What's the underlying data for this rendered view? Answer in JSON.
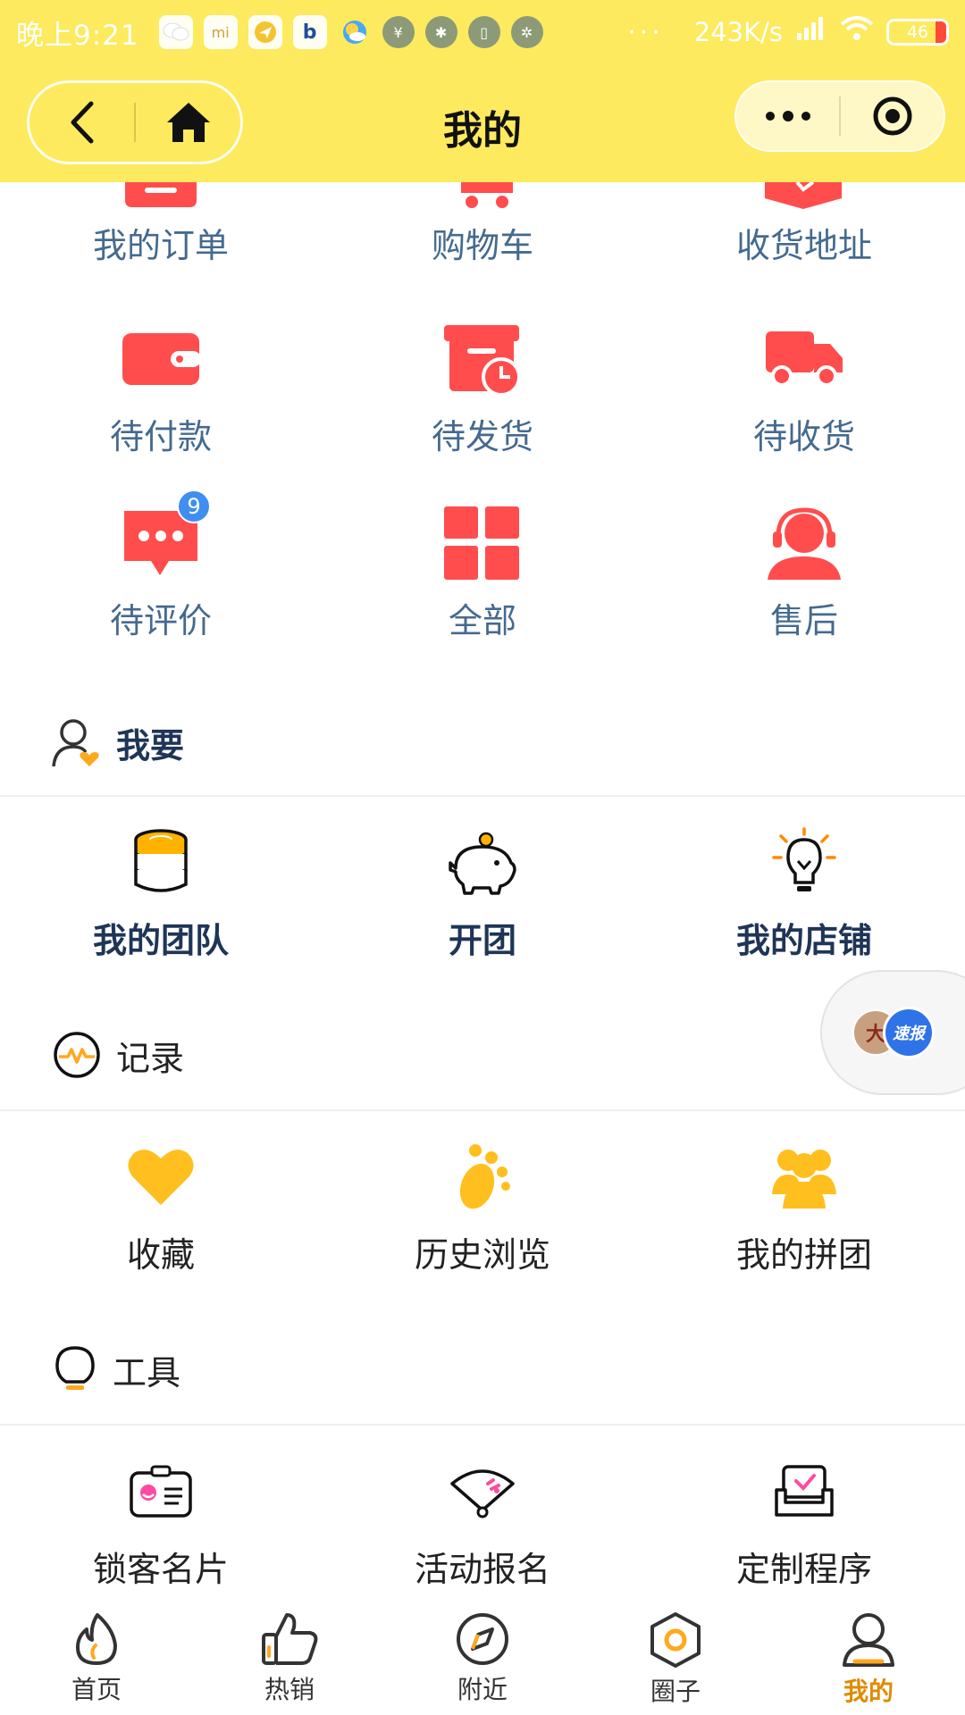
{
  "status_bar": {
    "time": "晚上9:21",
    "speed": "243K/s",
    "battery": "46"
  },
  "nav": {
    "title": "我的"
  },
  "orders": {
    "row1": [
      {
        "label": "我的订单",
        "icon": "order-icon"
      },
      {
        "label": "购物车",
        "icon": "cart-icon"
      },
      {
        "label": "收货地址",
        "icon": "address-icon"
      }
    ],
    "row2": [
      {
        "label": "待付款",
        "icon": "wallet-icon"
      },
      {
        "label": "待发货",
        "icon": "box-clock-icon"
      },
      {
        "label": "待收货",
        "icon": "truck-icon"
      }
    ],
    "row3": [
      {
        "label": "待评价",
        "icon": "chat-bubble-icon",
        "badge": "9"
      },
      {
        "label": "全部",
        "icon": "grid-icon"
      },
      {
        "label": "售后",
        "icon": "headset-icon"
      }
    ]
  },
  "want": {
    "title": "我要",
    "items": [
      {
        "label": "我的团队",
        "icon": "coin-stack-icon"
      },
      {
        "label": "开团",
        "icon": "piggy-bank-icon"
      },
      {
        "label": "我的店铺",
        "icon": "lightbulb-icon"
      }
    ]
  },
  "records": {
    "title": "记录",
    "items": [
      {
        "label": "收藏",
        "icon": "heart-icon"
      },
      {
        "label": "历史浏览",
        "icon": "footprint-icon"
      },
      {
        "label": "我的拼团",
        "icon": "group-icon"
      }
    ]
  },
  "tools": {
    "title": "工具",
    "items": [
      {
        "label": "锁客名片",
        "icon": "card-icon"
      },
      {
        "label": "活动报名",
        "icon": "fan-icon"
      },
      {
        "label": "定制程序",
        "icon": "sofa-icon"
      }
    ]
  },
  "floating": {
    "avatar_text": "大",
    "badge_text": "速报"
  },
  "tabbar": [
    {
      "label": "首页",
      "icon": "flame-icon"
    },
    {
      "label": "热销",
      "icon": "thumbs-up-icon"
    },
    {
      "label": "附近",
      "icon": "compass-icon"
    },
    {
      "label": "圈子",
      "icon": "hexagon-icon"
    },
    {
      "label": "我的",
      "icon": "person-icon",
      "active": true
    }
  ],
  "colors": {
    "header_yellow": "#fdea5e",
    "icon_red": "#ff4d4d",
    "icon_orange": "#ffb300",
    "label_blue": "#456a8f",
    "label_navy": "#1e3557",
    "tab_active": "#e08a00",
    "badge_blue": "#3f8ef0"
  }
}
